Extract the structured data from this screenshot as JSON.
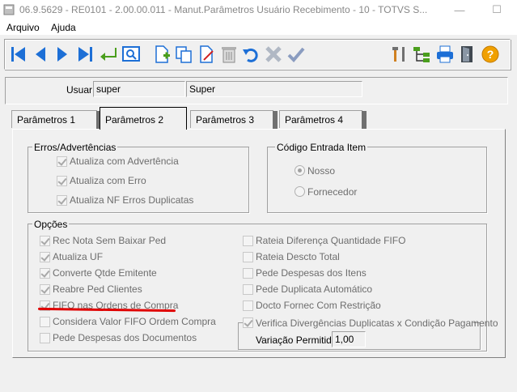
{
  "window": {
    "title": "06.9.5629 - RE0101 - 2.00.00.011 - Manut.Parâmetros Usuário Recebimento - 10 - TOTVS S...",
    "minimize": "—",
    "maximize": "☐",
    "close": "✕"
  },
  "menu": {
    "arquivo": "Arquivo",
    "ajuda": "Ajuda"
  },
  "toolbar": {
    "buttons": [
      "first-record",
      "previous-record",
      "next-record",
      "last-record",
      "go-to",
      "search",
      "add",
      "copy",
      "edit",
      "delete",
      "undo",
      "cancel",
      "confirm",
      "tools",
      "tree",
      "print",
      "exit",
      "help"
    ]
  },
  "user": {
    "label": "Usuar:",
    "code": "super",
    "name": "Super"
  },
  "tabs": [
    {
      "label": "Parâmetros 1"
    },
    {
      "label": "Parâmetros 2"
    },
    {
      "label": "Parâmetros 3"
    },
    {
      "label": "Parâmetros 4"
    }
  ],
  "erros": {
    "title": "Erros/Advertências",
    "items": [
      {
        "label": "Atualiza com Advertência",
        "checked": true
      },
      {
        "label": "Atualiza com Erro",
        "checked": true
      },
      {
        "label": "Atualiza NF Erros Duplicatas",
        "checked": true
      }
    ]
  },
  "codigo": {
    "title": "Código Entrada Item",
    "options": [
      {
        "label": "Nosso",
        "selected": true
      },
      {
        "label": "Fornecedor",
        "selected": false
      }
    ]
  },
  "opcoes": {
    "title": "Opções",
    "left": [
      {
        "label": "Rec Nota Sem Baixar Ped",
        "checked": true
      },
      {
        "label": "Atualiza UF",
        "checked": true
      },
      {
        "label": "Converte Qtde Emitente",
        "checked": true
      },
      {
        "label": "Reabre Ped Clientes",
        "checked": true
      },
      {
        "label": "FIFO nas Ordens de Compra",
        "checked": true
      },
      {
        "label": "Considera Valor FIFO Ordem Compra",
        "checked": false
      },
      {
        "label": "Pede Despesas dos Documentos",
        "checked": false
      }
    ],
    "right": [
      {
        "label": "Rateia Diferença Quantidade FIFO",
        "checked": false
      },
      {
        "label": "Rateia Descto Total",
        "checked": false
      },
      {
        "label": "Pede Despesas dos Itens",
        "checked": false
      },
      {
        "label": "Pede Duplicata Automático",
        "checked": false
      },
      {
        "label": "Docto Fornec Com Restrição",
        "checked": false
      }
    ],
    "verifica": {
      "label": "Verifica Divergências Duplicatas x Condição Pagamento",
      "checked": true
    },
    "variacao_label": "Variação Permitida:",
    "variacao_value": "1,00"
  },
  "colors": {
    "highlight_underline": "#e00000",
    "toolbar_blue": "#1d6fd6",
    "toolbar_green": "#4a9e1c",
    "help_orange": "#f0a000"
  }
}
